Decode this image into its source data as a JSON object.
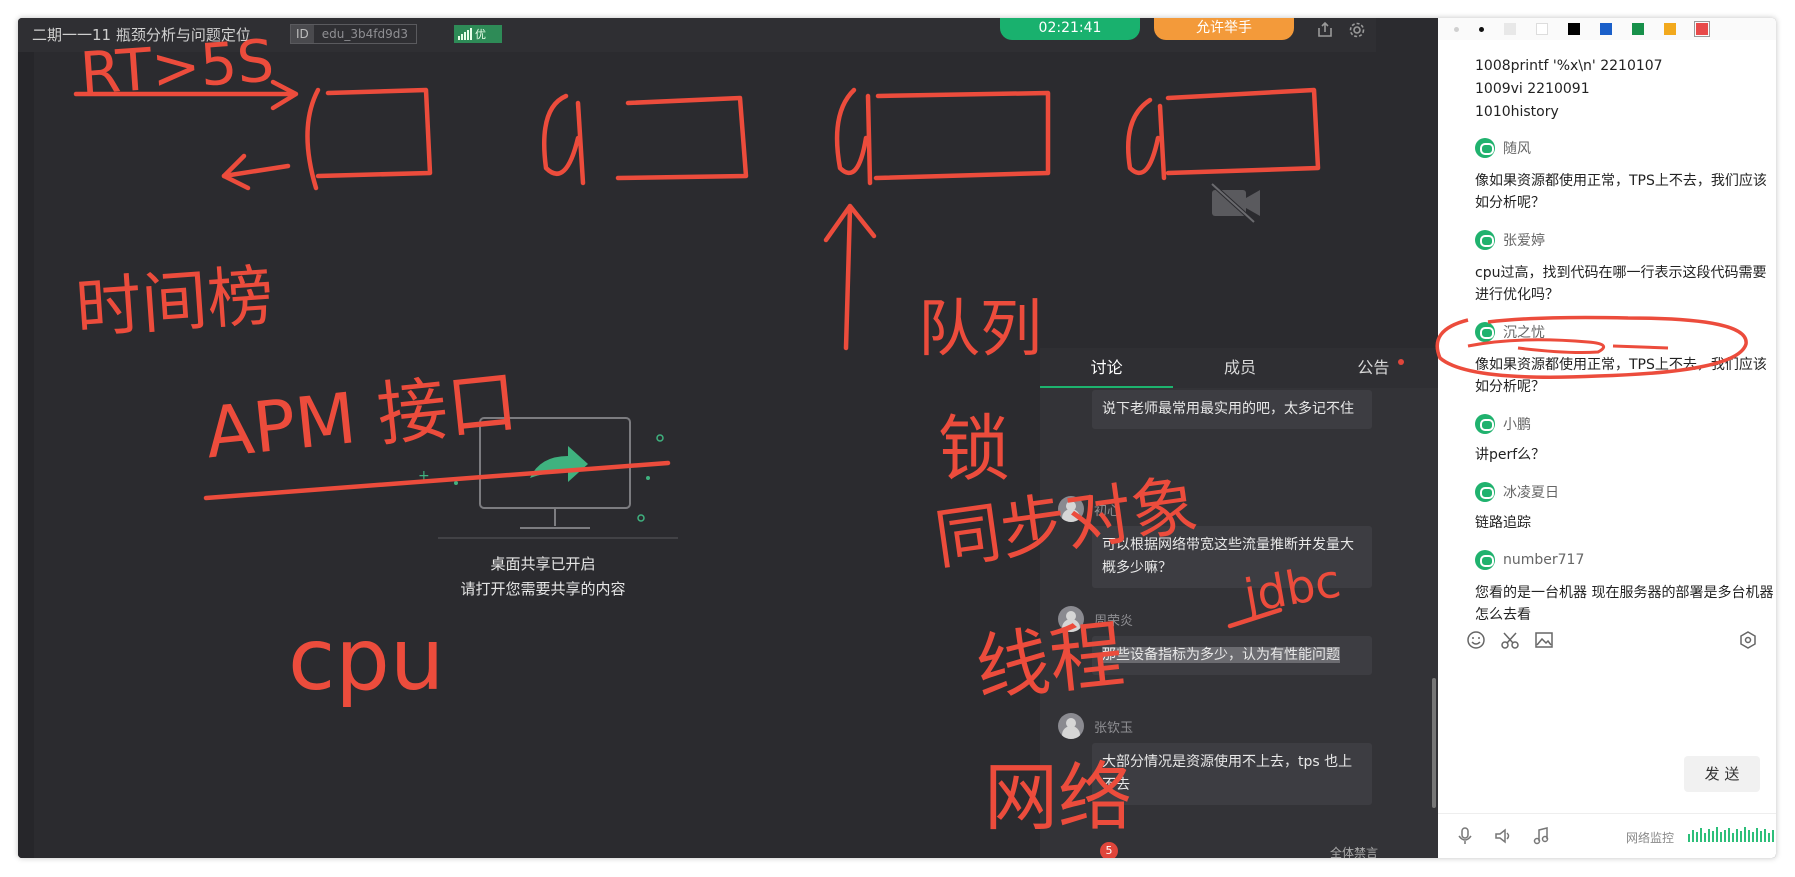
{
  "topbar": {
    "title": "二期一一11 瓶颈分析与问题定位",
    "id_label": "ID",
    "id_value": "edu_3b4fd9d3",
    "signal_label": "优",
    "timer": "02:21:41",
    "raise_hand": "允许举手"
  },
  "screen_share": {
    "title": "桌面共享已开启",
    "subtitle": "请打开您需要共享的内容"
  },
  "handwriting": {
    "rt": "RT>5S",
    "time_label": "时间榜",
    "apm": "APM 接口",
    "cpu": "cpu",
    "queue": "队列",
    "lock": "锁",
    "sync": "同步对象",
    "thread": "线程",
    "jdbc": "jdbc",
    "network": "网络"
  },
  "discussion": {
    "tabs": [
      "讨论",
      "成员",
      "公告"
    ],
    "messages": [
      {
        "name": "",
        "text": "说下老师最常用最实用的吧，太多记不住"
      },
      {
        "name": "初心",
        "text": "可以根据网络带宽这些流量推断并发量大概多少嘛？"
      },
      {
        "name": "周荣炎",
        "text": "那些设备指标为多少，认为有性能问题"
      },
      {
        "name": "张钦玉",
        "text": "大部分情况是资源使用不上去，tps 也上不去"
      }
    ],
    "like_count": "5",
    "mute_all": "全体禁言"
  },
  "chat": {
    "lines": [
      "1008printf '%x\\n' 2210107",
      "1009vi 2210091",
      "1010history"
    ],
    "messages": [
      {
        "name": "随风",
        "text": "像如果资源都使用正常，TPS上不去，我们应该如分析呢？"
      },
      {
        "name": "张爱婷",
        "text": "cpu过高，找到代码在哪一行表示这段代码需要进行优化吗？"
      },
      {
        "name": "沉之忧",
        "text": "像如果资源都使用正常，TPS上不去，我们应该如分析呢？"
      },
      {
        "name": "小鹏",
        "text": "讲perf么？"
      },
      {
        "name": "冰凌夏日",
        "text": "链路追踪"
      },
      {
        "name": "number717",
        "text": "您看的是一台机器 现在服务器的部署是多台机器 怎么去看"
      }
    ],
    "send_label": "发 送",
    "net_monitor": "网络监控"
  },
  "colors": {
    "ink": "#ec4c3c",
    "accent_green": "#19b16e",
    "raise_orange": "#f39a3a",
    "toolbar_swatches": [
      "#ffffff",
      "#000000",
      "#1a5fc9",
      "#17904a",
      "#f2a91d",
      "#e84a4a"
    ]
  },
  "icons": {
    "share": "share-icon",
    "settings": "gear-icon",
    "camera_off": "camera-off-icon",
    "emoji": "emoji-icon",
    "scissors": "scissors-icon",
    "image": "image-icon",
    "hexagon": "hexagon-icon",
    "mic": "mic-icon",
    "speaker": "speaker-icon",
    "music": "music-icon"
  }
}
